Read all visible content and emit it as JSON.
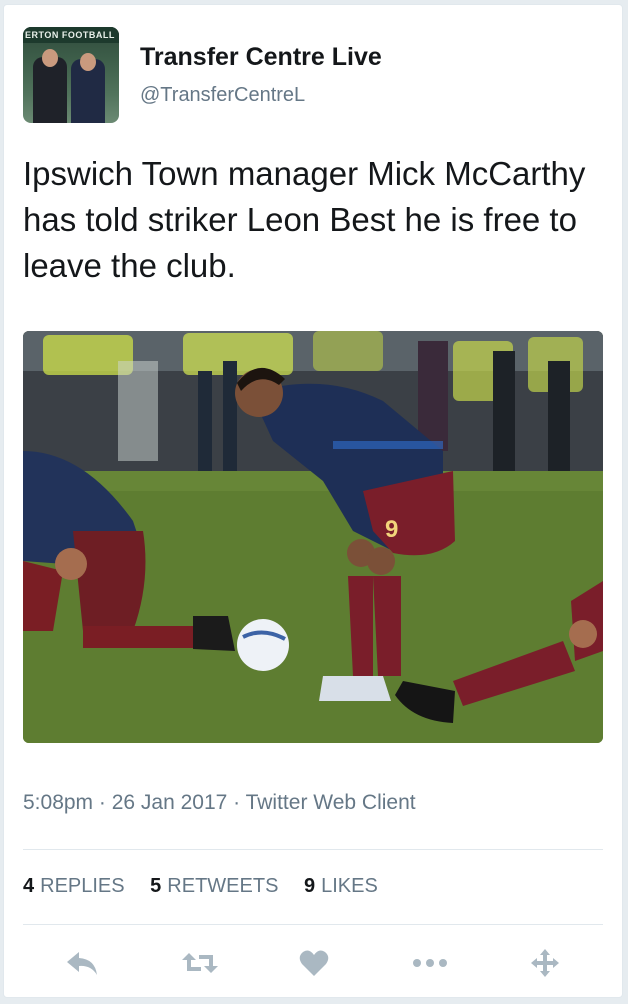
{
  "user": {
    "display_name": "Transfer Centre Live",
    "handle": "@TransferCentreL",
    "avatar_banner_text": "ERTON FOOTBALL"
  },
  "tweet": {
    "text": "Ipswich Town manager Mick McCarthy has told striker Leon Best he is free to leave the club.",
    "timestamp": "5:08pm · 26 Jan 2017 · Twitter Web Client"
  },
  "stats": {
    "replies": {
      "count": "4",
      "label": "REPLIES"
    },
    "retweets": {
      "count": "5",
      "label": "RETWEETS"
    },
    "likes": {
      "count": "9",
      "label": "LIKES"
    }
  },
  "actions": [
    {
      "name": "reply-icon"
    },
    {
      "name": "retweet-icon"
    },
    {
      "name": "like-heart-icon"
    },
    {
      "name": "more-dots-icon"
    },
    {
      "name": "move-arrows-icon"
    }
  ],
  "colors": {
    "text_primary": "#14171a",
    "text_secondary": "#657786",
    "action_icon": "#aab8c2",
    "border": "#e1e8ed"
  },
  "media": {
    "shirt_number": "9"
  }
}
